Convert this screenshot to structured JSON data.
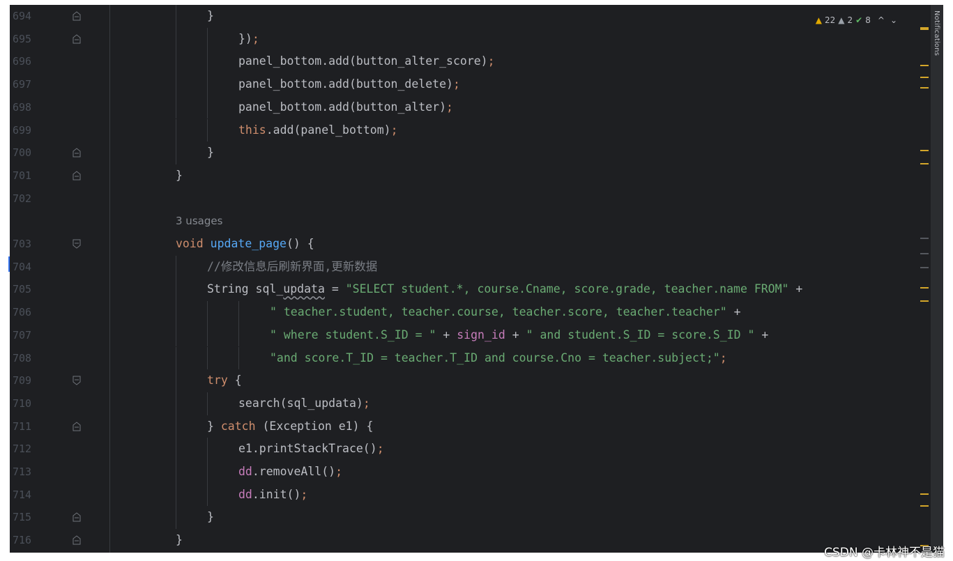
{
  "editor": {
    "inspection": {
      "warnings": "22",
      "weak_warnings": "2",
      "typos": "8",
      "up": "^",
      "down": "⌄"
    },
    "usage_hint": "3 usages",
    "lines": [
      {
        "n": "694",
        "fold": "end",
        "indent": 1,
        "tokens": [
          {
            "t": "}",
            "c": "p"
          }
        ]
      },
      {
        "n": "695",
        "fold": "end",
        "indent": 2,
        "tokens": [
          {
            "t": "})",
            "c": "p"
          },
          {
            "t": ";",
            "c": "kw"
          }
        ]
      },
      {
        "n": "696",
        "fold": "",
        "indent": 2,
        "tokens": [
          {
            "t": "panel_bottom.add(button_alter_score)",
            "c": "p"
          },
          {
            "t": ";",
            "c": "kw"
          }
        ]
      },
      {
        "n": "697",
        "fold": "",
        "indent": 2,
        "tokens": [
          {
            "t": "panel_bottom.add(button_delete)",
            "c": "p"
          },
          {
            "t": ";",
            "c": "kw"
          }
        ]
      },
      {
        "n": "698",
        "fold": "",
        "indent": 2,
        "tokens": [
          {
            "t": "panel_bottom.add(button_alter)",
            "c": "p"
          },
          {
            "t": ";",
            "c": "kw"
          }
        ]
      },
      {
        "n": "699",
        "fold": "",
        "indent": 2,
        "tokens": [
          {
            "t": "this",
            "c": "kw"
          },
          {
            "t": ".add(panel_bottom)",
            "c": "p"
          },
          {
            "t": ";",
            "c": "kw"
          }
        ]
      },
      {
        "n": "700",
        "fold": "end",
        "indent": 1,
        "tokens": [
          {
            "t": "}",
            "c": "p"
          }
        ]
      },
      {
        "n": "701",
        "fold": "end",
        "indent": 0,
        "tokens": [
          {
            "t": "}",
            "c": "p"
          }
        ]
      },
      {
        "n": "702",
        "fold": "",
        "indent": 0,
        "tokens": []
      },
      {
        "n": "703",
        "fold": "start",
        "indent": 0,
        "hint_before": true,
        "tokens": [
          {
            "t": "void ",
            "c": "kw"
          },
          {
            "t": "update_page",
            "c": "fn"
          },
          {
            "t": "() {",
            "c": "p"
          }
        ]
      },
      {
        "n": "704",
        "fold": "",
        "indent": 1,
        "tokens": [
          {
            "t": "//修改信息后刷新界面,更新数据",
            "c": "cmt"
          }
        ]
      },
      {
        "n": "705",
        "fold": "",
        "indent": 1,
        "tokens": [
          {
            "t": "String ",
            "c": "p"
          },
          {
            "t": "sql_",
            "c": "p"
          },
          {
            "t": "updata",
            "c": "wavy"
          },
          {
            "t": " = ",
            "c": "p"
          },
          {
            "t": "\"SELECT student.*, course.Cname, score.grade, teacher.name FROM\"",
            "c": "str"
          },
          {
            "t": " +",
            "c": "p"
          }
        ]
      },
      {
        "n": "706",
        "fold": "",
        "indent": 3,
        "tokens": [
          {
            "t": "\" teacher.student, teacher.course, teacher.score, teacher.teacher\"",
            "c": "str"
          },
          {
            "t": " +",
            "c": "p"
          }
        ]
      },
      {
        "n": "707",
        "fold": "",
        "indent": 3,
        "tokens": [
          {
            "t": "\" where student.S_ID = \"",
            "c": "str"
          },
          {
            "t": " + ",
            "c": "p"
          },
          {
            "t": "sign_id",
            "c": "fld"
          },
          {
            "t": " + ",
            "c": "p"
          },
          {
            "t": "\" and student.S_ID = score.S_ID \"",
            "c": "str"
          },
          {
            "t": " +",
            "c": "p"
          }
        ]
      },
      {
        "n": "708",
        "fold": "",
        "indent": 3,
        "tokens": [
          {
            "t": "\"and score.T_ID = teacher.T_ID and course.Cno = teacher.subject;\"",
            "c": "str"
          },
          {
            "t": ";",
            "c": "kw"
          }
        ]
      },
      {
        "n": "709",
        "fold": "start",
        "indent": 1,
        "tokens": [
          {
            "t": "try",
            "c": "kw"
          },
          {
            "t": " {",
            "c": "p"
          }
        ]
      },
      {
        "n": "710",
        "fold": "",
        "indent": 2,
        "tokens": [
          {
            "t": "search(sql_updata)",
            "c": "p"
          },
          {
            "t": ";",
            "c": "kw"
          }
        ]
      },
      {
        "n": "711",
        "fold": "end",
        "indent": 1,
        "tokens": [
          {
            "t": "} ",
            "c": "p"
          },
          {
            "t": "catch",
            "c": "kw"
          },
          {
            "t": " (Exception e1) {",
            "c": "p"
          }
        ]
      },
      {
        "n": "712",
        "fold": "",
        "indent": 2,
        "tokens": [
          {
            "t": "e1.printStackTrace()",
            "c": "p"
          },
          {
            "t": ";",
            "c": "kw"
          }
        ]
      },
      {
        "n": "713",
        "fold": "",
        "indent": 2,
        "tokens": [
          {
            "t": "dd",
            "c": "fld"
          },
          {
            "t": ".removeAll()",
            "c": "p"
          },
          {
            "t": ";",
            "c": "kw"
          }
        ]
      },
      {
        "n": "714",
        "fold": "",
        "indent": 2,
        "tokens": [
          {
            "t": "dd",
            "c": "fld"
          },
          {
            "t": ".init()",
            "c": "p"
          },
          {
            "t": ";",
            "c": "kw"
          }
        ]
      },
      {
        "n": "715",
        "fold": "end",
        "indent": 1,
        "tokens": [
          {
            "t": "}",
            "c": "p"
          }
        ]
      },
      {
        "n": "716",
        "fold": "end",
        "indent": 0,
        "tokens": [
          {
            "t": "}",
            "c": "p"
          }
        ]
      }
    ]
  },
  "notifications_label": "Notifications",
  "watermark": "CSDN @卡林神不是猫",
  "colors": {
    "bg": "#1e1f22",
    "keyword": "#cf8e6d",
    "string": "#6aab73",
    "function": "#56a8f5",
    "field": "#c77dbb",
    "comment": "#7a7e85",
    "warning": "#d4a62a"
  }
}
